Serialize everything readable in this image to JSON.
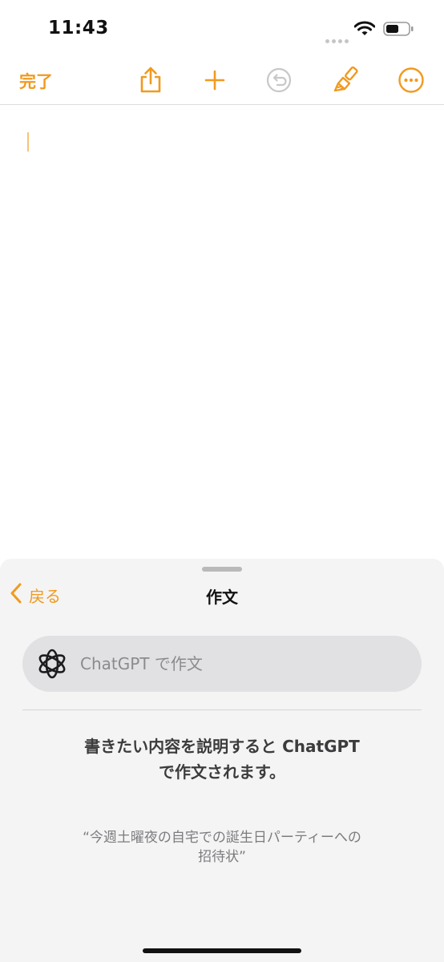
{
  "status_bar": {
    "time": "11:43"
  },
  "toolbar": {
    "done_label": "完了",
    "icons": [
      "share-icon",
      "plus-icon",
      "undo-icon",
      "paintbrush-icon",
      "more-icon"
    ],
    "accent": "#f19a1e"
  },
  "sheet": {
    "back_label": "戻る",
    "title": "作文",
    "compose_placeholder": "ChatGPT で作文",
    "description_line1": "書きたい内容を説明すると ChatGPT",
    "description_line2": "で作文されます。",
    "example_line1": "“今週土曜夜の自宅での誕生日パーティーへの",
    "example_line2": "招待状”"
  }
}
